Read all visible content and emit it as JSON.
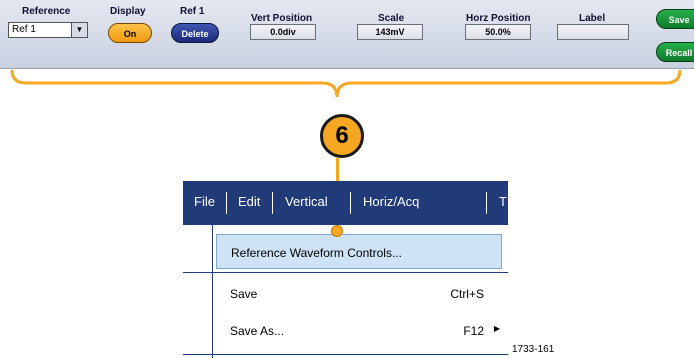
{
  "control_bar": {
    "reference": {
      "label": "Reference",
      "value": "Ref 1"
    },
    "display": {
      "label": "Display",
      "button": "On"
    },
    "ref1": {
      "label": "Ref 1",
      "button": "Delete"
    },
    "vert_position": {
      "label": "Vert Position",
      "value": "0.0div"
    },
    "scale": {
      "label": "Scale",
      "value": "143mV"
    },
    "horz_position": {
      "label": "Horz Position",
      "value": "50.0%"
    },
    "label_field": {
      "label": "Label",
      "value": ""
    },
    "save_button": "Save",
    "recall_button": "Recall"
  },
  "callout": {
    "number": "6"
  },
  "menubar": {
    "items": [
      "File",
      "Edit",
      "Vertical",
      "Horiz/Acq",
      "T"
    ]
  },
  "menu": {
    "items": [
      {
        "label": "Reference Waveform Controls...",
        "shortcut": ""
      },
      {
        "label": "Save",
        "shortcut": "Ctrl+S"
      },
      {
        "label": "Save As...",
        "shortcut": "F12"
      }
    ]
  },
  "figure_id": "1733-161",
  "colors": {
    "menubar": "#213a78",
    "callout": "#f6a823",
    "highlight": "#cfe3f6"
  }
}
